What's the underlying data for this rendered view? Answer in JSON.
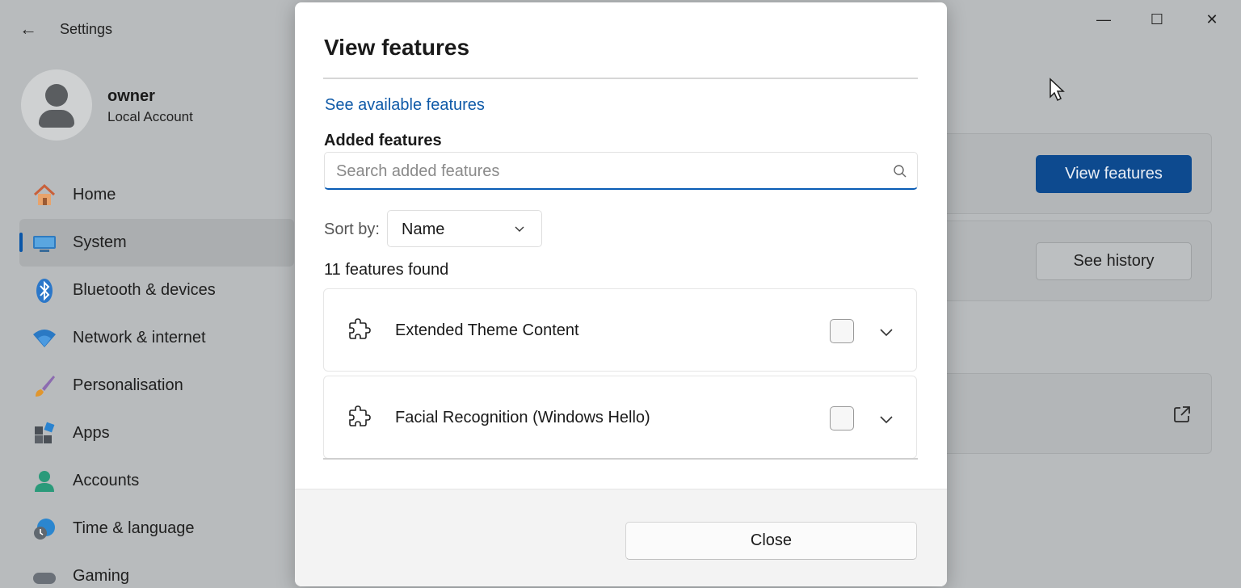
{
  "window": {
    "back_glyph": "←",
    "title": "Settings",
    "minimize_glyph": "—",
    "maximize_glyph": "☐",
    "close_glyph": "✕"
  },
  "profile": {
    "name": "owner",
    "account_type": "Local Account"
  },
  "sidebar": {
    "items": [
      {
        "label": "Home",
        "icon": "home-icon",
        "active": false
      },
      {
        "label": "System",
        "icon": "system-icon",
        "active": true
      },
      {
        "label": "Bluetooth & devices",
        "icon": "bluetooth-icon",
        "active": false
      },
      {
        "label": "Network & internet",
        "icon": "wifi-icon",
        "active": false
      },
      {
        "label": "Personalisation",
        "icon": "brush-icon",
        "active": false
      },
      {
        "label": "Apps",
        "icon": "apps-icon",
        "active": false
      },
      {
        "label": "Accounts",
        "icon": "person-icon",
        "active": false
      },
      {
        "label": "Time & language",
        "icon": "globe-clock-icon",
        "active": false
      },
      {
        "label": "Gaming",
        "icon": "gamepad-icon",
        "active": false
      }
    ]
  },
  "background_content": {
    "view_features_label": "View features",
    "see_history_label": "See history",
    "external_link_icon": "external-link-icon"
  },
  "dialog": {
    "title": "View features",
    "available_link": "See available features",
    "added_label": "Added features",
    "search_placeholder": "Search added features",
    "sort_label": "Sort by:",
    "sort_value": "Name",
    "found_count": "11 features found",
    "features": [
      {
        "name": "Extended Theme Content",
        "icon": "puzzle-icon",
        "checked": false
      },
      {
        "name": "Facial Recognition (Windows Hello)",
        "icon": "puzzle-icon",
        "checked": false
      }
    ],
    "close_label": "Close"
  },
  "colors": {
    "accent": "#0f5aa8",
    "primary_button_bg": "#0d4a8f",
    "dim_overlay": "#b8bbbd"
  }
}
